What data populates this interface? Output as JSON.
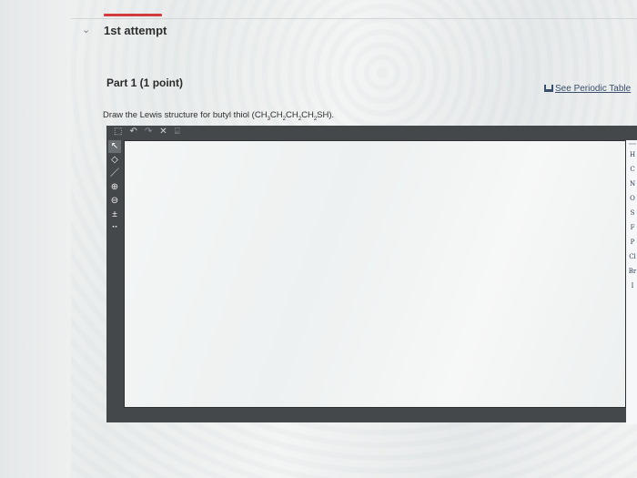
{
  "attempt": {
    "chevron": "⌄",
    "title": "1st attempt"
  },
  "part": {
    "title": "Part 1  (1 point)"
  },
  "periodic_table": {
    "icon": "periodic-table-icon",
    "label": "See Periodic Table"
  },
  "question": {
    "prefix": "Draw the Lewis structure for butyl thiol (",
    "formula": [
      "CH",
      "3",
      "CH",
      "2",
      "CH",
      "2",
      "CH",
      "2",
      "SH"
    ],
    "suffix": ")."
  },
  "editor": {
    "top_toolbar": [
      {
        "name": "select-icon",
        "glyph": "⬚"
      },
      {
        "name": "undo-icon",
        "glyph": "↶"
      },
      {
        "name": "redo-icon",
        "glyph": "↷"
      },
      {
        "name": "clear-icon",
        "glyph": "✕"
      },
      {
        "name": "template-icon",
        "glyph": "⌸"
      }
    ],
    "left_tools": [
      {
        "name": "arrow-select-tool",
        "glyph": "↖",
        "selected": true
      },
      {
        "name": "eraser-tool",
        "glyph": "◇"
      },
      {
        "name": "single-bond-tool",
        "glyph": "／"
      },
      {
        "name": "positive-charge-tool",
        "glyph": "⊕"
      },
      {
        "name": "negative-charge-tool",
        "glyph": "⊖"
      },
      {
        "name": "increase-charge-tool",
        "glyph": "±"
      },
      {
        "name": "lone-pair-tool",
        "glyph": "⠒"
      }
    ],
    "elements": [
      "H",
      "C",
      "N",
      "O",
      "S",
      "F",
      "P",
      "Cl",
      "Br",
      "I"
    ]
  }
}
